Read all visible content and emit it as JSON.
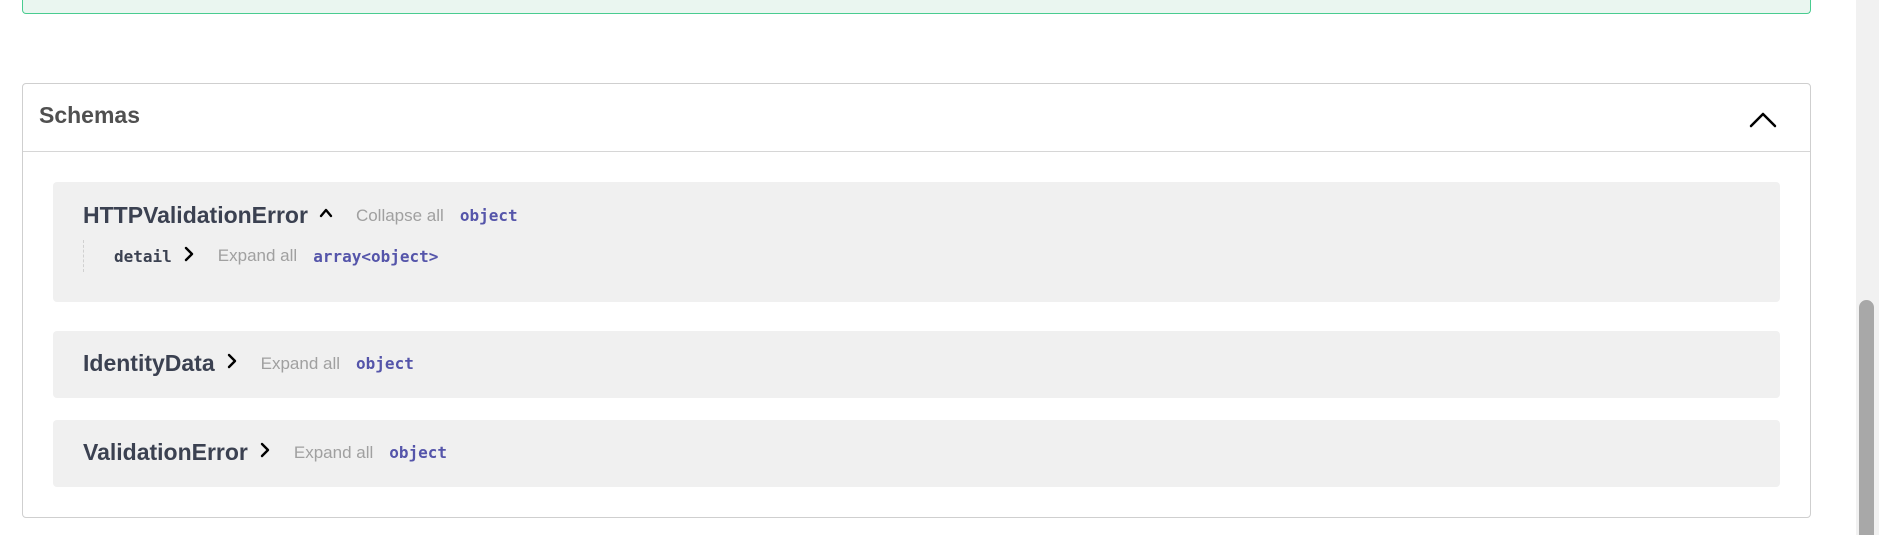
{
  "section": {
    "title": "Schemas",
    "toggle_icon": "chevron-up-icon"
  },
  "models": [
    {
      "name": "HTTPValidationError",
      "expanded": true,
      "toggle_label": "Collapse all",
      "type": "object",
      "properties": [
        {
          "name": "detail",
          "toggle_label": "Expand all",
          "type": "array<object>"
        }
      ]
    },
    {
      "name": "IdentityData",
      "expanded": false,
      "toggle_label": "Expand all",
      "type": "object"
    },
    {
      "name": "ValidationError",
      "expanded": false,
      "toggle_label": "Expand all",
      "type": "object"
    }
  ],
  "colors": {
    "type_text": "#5555aa",
    "muted_link": "#a0a0a0",
    "model_bg": "#f0f0f0",
    "success_border": "#49cc90"
  }
}
